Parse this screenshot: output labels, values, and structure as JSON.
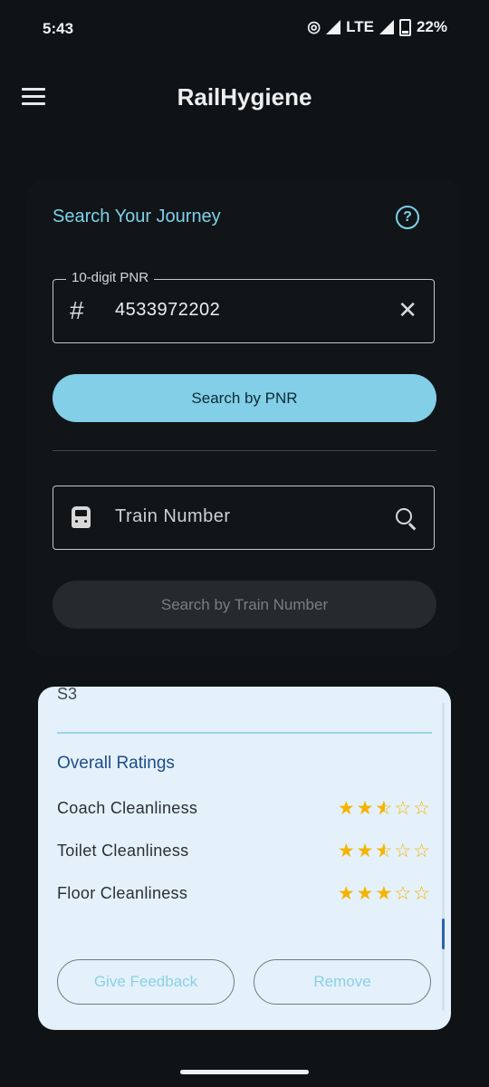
{
  "status": {
    "time": "5:43",
    "network": "LTE",
    "battery": "22%"
  },
  "appbar": {
    "title": "RailHygiene"
  },
  "search_card": {
    "title": "Search Your Journey",
    "pnr": {
      "legend": "10-digit PNR",
      "value": "4533972202",
      "lead_icon": "#"
    },
    "pnr_button": "Search by PNR",
    "train": {
      "placeholder": "Train Number"
    },
    "train_button": "Search by Train Number"
  },
  "result_card": {
    "clipped_text": "S3",
    "section_title": "Overall Ratings",
    "ratings": [
      {
        "label": "Coach Cleanliness",
        "stars": 2.5
      },
      {
        "label": "Toilet Cleanliness",
        "stars": 2.5
      },
      {
        "label": "Floor Cleanliness",
        "stars": 3
      }
    ],
    "feedback_button": "Give Feedback",
    "remove_button": "Remove"
  },
  "colors": {
    "accent": "#82cfe7",
    "star": "#f5b400",
    "section_title": "#1e4c8a"
  }
}
